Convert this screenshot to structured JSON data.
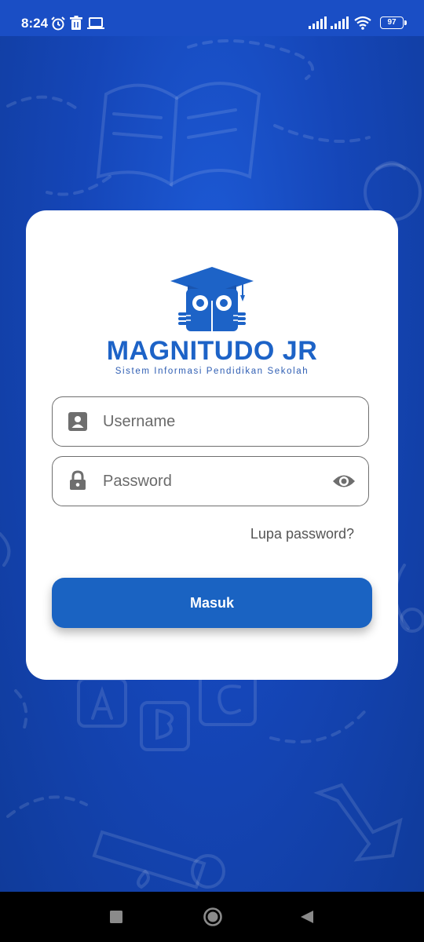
{
  "status_bar": {
    "time": "8:24",
    "battery_level": "97",
    "left_icons": [
      "alarm-icon",
      "trash-icon",
      "laptop-icon"
    ],
    "right_icons": [
      "signal-icon",
      "signal-icon",
      "wifi-icon",
      "battery-icon"
    ]
  },
  "login": {
    "brand_name": "MAGNITUDO JR",
    "tagline": "Sistem Informasi Pendidikan Sekolah",
    "username_placeholder": "Username",
    "password_placeholder": "Password",
    "forgot_password": "Lupa password?",
    "submit_label": "Masuk"
  },
  "nav_bar": {
    "buttons": [
      "recents-button",
      "home-button",
      "back-button"
    ]
  },
  "colors": {
    "background": "#1546b8",
    "primary": "#1a63c2",
    "brand_text": "#1d63c7",
    "card": "#ffffff"
  }
}
